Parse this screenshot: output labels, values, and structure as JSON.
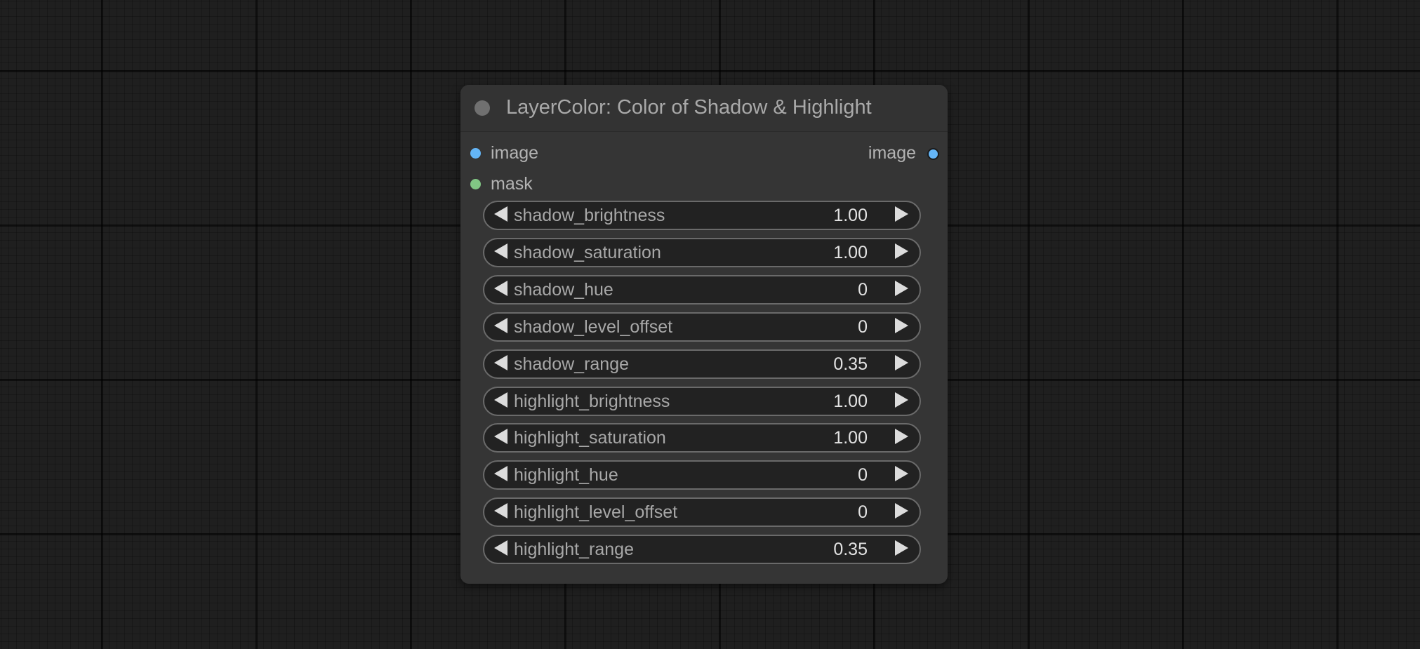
{
  "node": {
    "title": "LayerColor: Color of Shadow & Highlight",
    "inputs": [
      {
        "label": "image",
        "color": "#64b5f6"
      },
      {
        "label": "mask",
        "color": "#81c784"
      }
    ],
    "outputs": [
      {
        "label": "image",
        "color": "#64b5f6"
      }
    ],
    "widgets": [
      {
        "label": "shadow_brightness",
        "value": "1.00"
      },
      {
        "label": "shadow_saturation",
        "value": "1.00"
      },
      {
        "label": "shadow_hue",
        "value": "0"
      },
      {
        "label": "shadow_level_offset",
        "value": "0"
      },
      {
        "label": "shadow_range",
        "value": "0.35"
      },
      {
        "label": "highlight_brightness",
        "value": "1.00"
      },
      {
        "label": "highlight_saturation",
        "value": "1.00"
      },
      {
        "label": "highlight_hue",
        "value": "0"
      },
      {
        "label": "highlight_level_offset",
        "value": "0"
      },
      {
        "label": "highlight_range",
        "value": "0.35"
      }
    ]
  },
  "icons": {
    "collapse": "circle-collapse-icon",
    "decrement": "triangle-left-icon",
    "increment": "triangle-right-icon"
  }
}
